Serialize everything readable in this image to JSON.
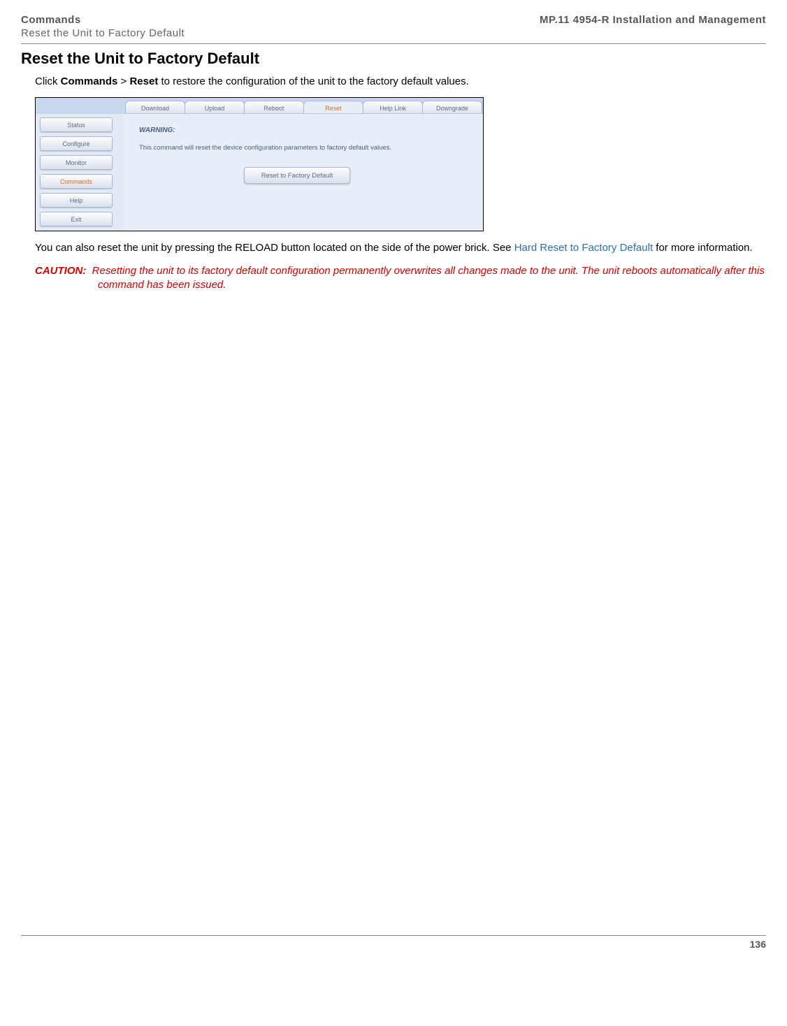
{
  "header": {
    "chapter": "Commands",
    "section": "Reset the Unit to Factory Default",
    "doc_title": "MP.11 4954-R Installation and Management"
  },
  "title": "Reset the Unit to Factory Default",
  "intro": {
    "pre": "Click ",
    "b1": "Commands",
    "mid": " > ",
    "b2": "Reset",
    "post": " to restore the configuration of the unit to the factory default values."
  },
  "screenshot": {
    "sidebar": [
      "Status",
      "Configure",
      "Monitor",
      "Commands",
      "Help",
      "Exit"
    ],
    "sidebar_active_index": 3,
    "tabs": [
      "Download",
      "Upload",
      "Reboot",
      "Reset",
      "Help Link",
      "Downgrade"
    ],
    "tabs_active_index": 3,
    "warning_label": "WARNING:",
    "warning_text": "This command will reset the device configuration parameters to factory default values.",
    "reset_button": "Reset to Factory Default"
  },
  "para2": {
    "pre": "You can also reset the unit by pressing the RELOAD button located on the side of the power brick. See ",
    "link": "Hard Reset to Factory Default",
    "post": " for more information."
  },
  "caution": {
    "label": "CAUTION:",
    "text": "Resetting the unit to its factory default configuration permanently overwrites all changes made to the unit. The unit reboots automatically after this command has been issued."
  },
  "page_number": "136"
}
